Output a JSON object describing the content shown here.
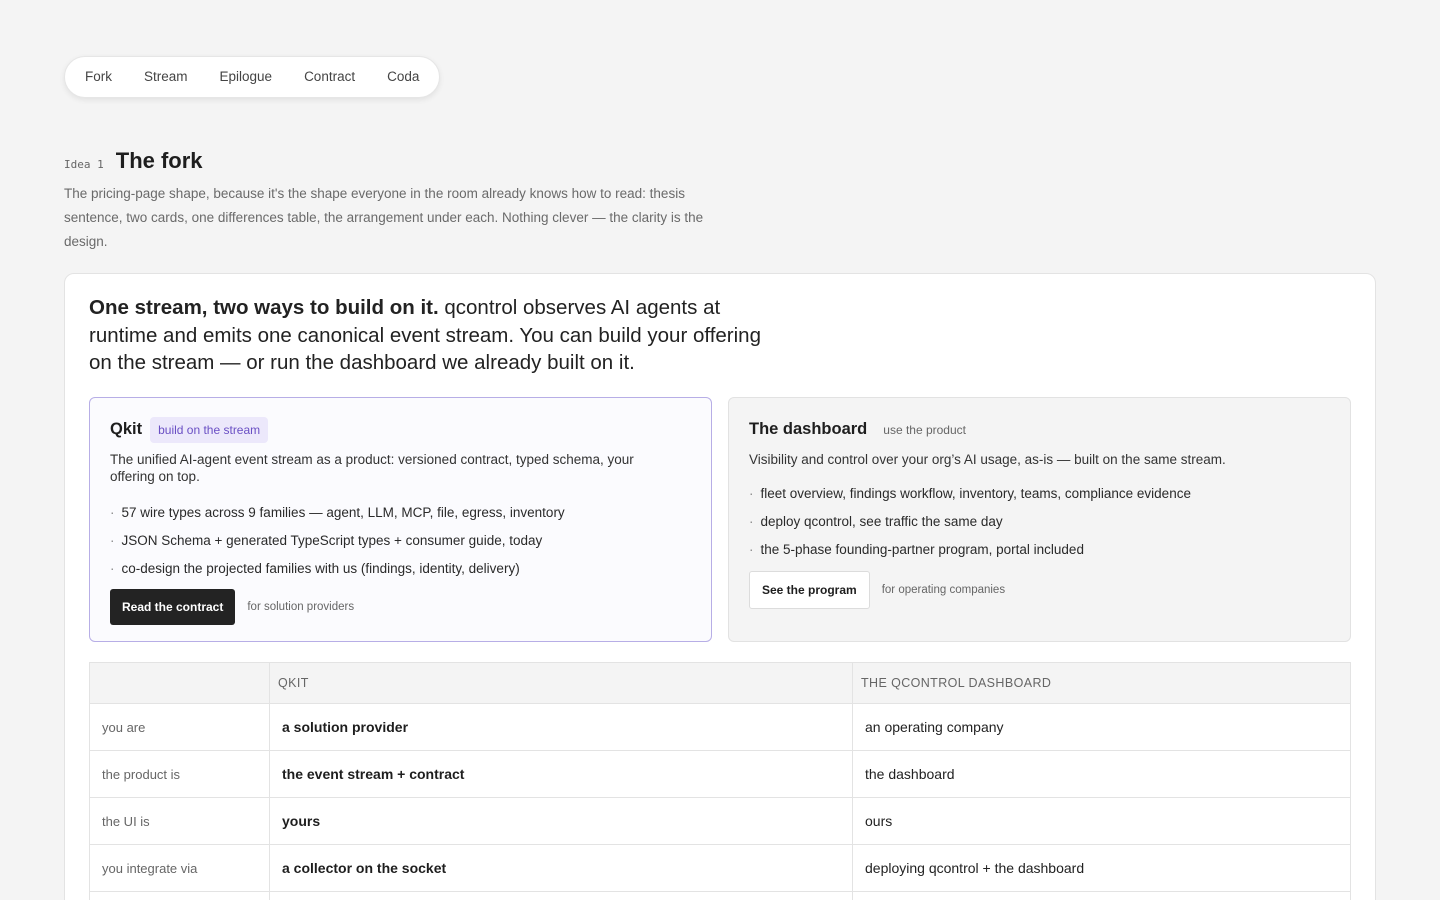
{
  "nav": {
    "items": [
      "Fork",
      "Stream",
      "Epilogue",
      "Contract",
      "Coda"
    ]
  },
  "idea": {
    "tag": "Idea 1",
    "title": "The fork",
    "description": "The pricing-page shape, because it's the shape everyone in the room already knows how to read: thesis sentence, two cards, one differences table, the arrangement under each. Nothing clever — the clarity is the design."
  },
  "thesis": {
    "lead": "One stream, two ways to build on it.",
    "rest": " qcontrol observes AI agents at runtime and emits one canonical event stream. You can build your offering on the stream — or run the dashboard we already built on it."
  },
  "cards": {
    "qkit": {
      "title": "Qkit",
      "badge": "build on the stream",
      "description": "The unified AI-agent event stream as a product: versioned contract, typed schema, your offering on top.",
      "bullets": [
        "57 wire types across 9 families — agent, LLM, MCP, file, egress, inventory",
        "JSON Schema + generated TypeScript types + consumer guide, today",
        "co-design the projected families with us (findings, identity, delivery)"
      ],
      "button": "Read the contract",
      "note": "for solution providers"
    },
    "dashboard": {
      "title": "The dashboard",
      "badge": "use the product",
      "description": "Visibility and control over your org’s AI usage, as-is — built on the same stream.",
      "bullets": [
        "fleet overview, findings workflow, inventory, teams, compliance evidence",
        "deploy qcontrol, see traffic the same day",
        "the 5-phase founding-partner program, portal included"
      ],
      "button": "See the program",
      "note": "for operating companies"
    }
  },
  "table": {
    "headers": [
      "",
      "QKIT",
      "THE QCONTROL DASHBOARD"
    ],
    "rows": [
      {
        "label": "you are",
        "qkit": "a solution provider",
        "dashboard": "an operating company"
      },
      {
        "label": "the product is",
        "qkit": "the event stream + contract",
        "dashboard": "the dashboard"
      },
      {
        "label": "the UI is",
        "qkit": "yours",
        "dashboard": "ours"
      },
      {
        "label": "you integrate via",
        "qkit": "a collector on the socket",
        "dashboard": "deploying qcontrol + the dashboard"
      }
    ]
  },
  "colors": {
    "accent_purple": "#6a4fc4",
    "badge_purple_bg": "#ece8fb",
    "qkit_border": "#b7aee6",
    "dark_button": "#232323",
    "page_bg": "#f4f4f4"
  }
}
